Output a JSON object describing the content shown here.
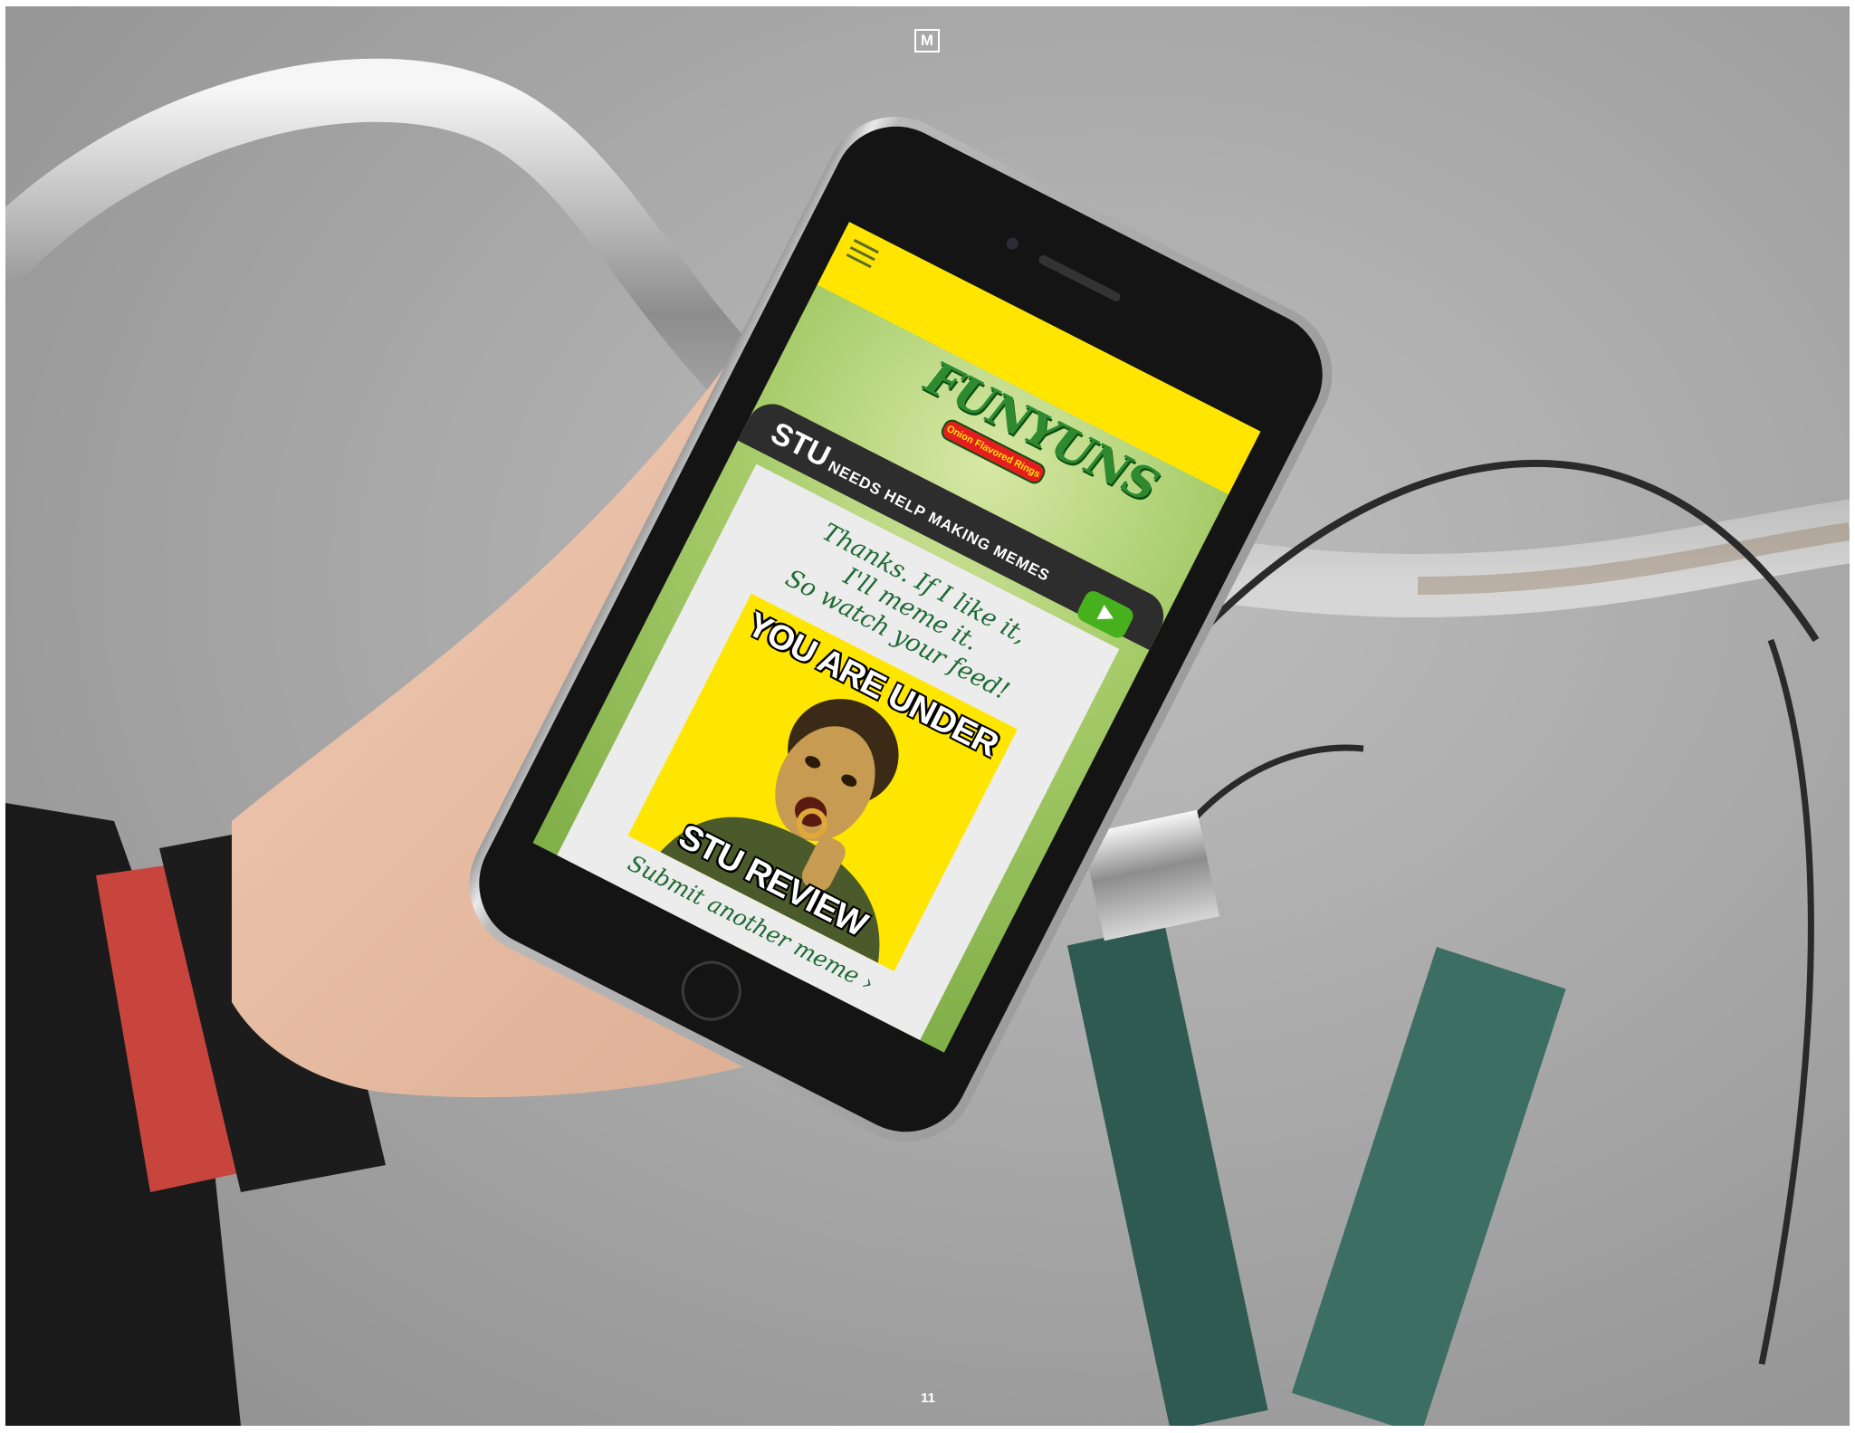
{
  "header": {
    "brand_mark": "M"
  },
  "footer": {
    "page_number": "11"
  },
  "app": {
    "logo_text": "FUNYUNS",
    "logo_tagline": "Onion Flavored Rings",
    "banner": {
      "name": "STU",
      "subtitle": "NEEDS HELP MAKING MEMES"
    },
    "message_lines": [
      "Thanks. If I like it,",
      "I'll meme it.",
      "So watch your feed!"
    ],
    "meme": {
      "top_text": "YOU ARE UNDER",
      "bottom_text": "STU REVIEW"
    },
    "submit_link": "Submit another meme ›"
  },
  "colors": {
    "brand_yellow": "#ffe500",
    "brand_green": "#2f8a2f",
    "play_green": "#46b11d",
    "script_green": "#1e6b33",
    "tagline_red": "#e41e1e"
  },
  "icons": [
    "menu-icon",
    "play-icon"
  ]
}
